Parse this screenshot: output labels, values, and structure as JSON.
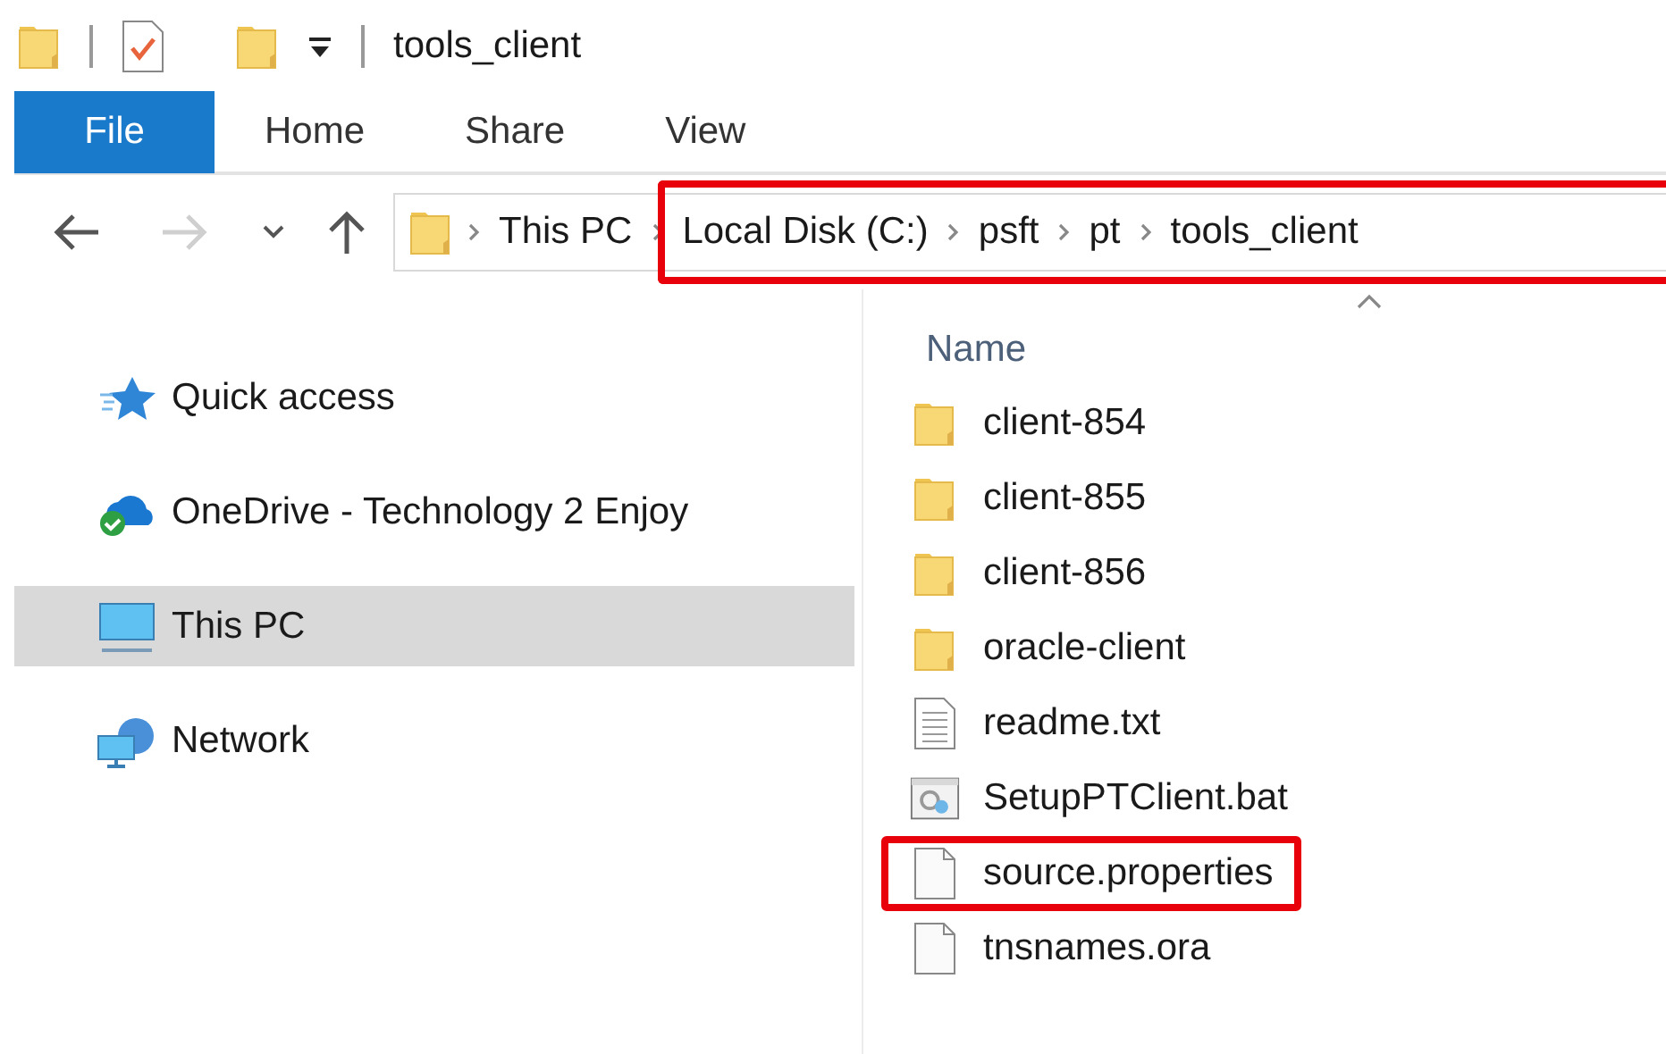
{
  "window": {
    "title": "tools_client"
  },
  "ribbon_tabs": [
    {
      "label": "File",
      "selected": true
    },
    {
      "label": "Home",
      "selected": false
    },
    {
      "label": "Share",
      "selected": false
    },
    {
      "label": "View",
      "selected": false
    }
  ],
  "nav_buttons": [
    {
      "kind": "back",
      "disabled": false
    },
    {
      "kind": "forward",
      "disabled": true
    },
    {
      "kind": "recent",
      "disabled": false
    },
    {
      "kind": "up",
      "disabled": false
    }
  ],
  "address_bar": {
    "segments": [
      {
        "label": "This PC",
        "highlighted": false
      },
      {
        "label": "Local Disk (C:)",
        "highlighted": true
      },
      {
        "label": "psft",
        "highlighted": true
      },
      {
        "label": "pt",
        "highlighted": true
      },
      {
        "label": "tools_client",
        "highlighted": true
      }
    ]
  },
  "sidebar": {
    "items": [
      {
        "label": "Quick access",
        "kind": "quick-access",
        "selected": false
      },
      {
        "label": "OneDrive - Technology 2 Enjoy",
        "kind": "cloud",
        "selected": false
      },
      {
        "label": "This PC",
        "kind": "computer",
        "selected": true
      },
      {
        "label": "Network",
        "kind": "network",
        "selected": false
      }
    ]
  },
  "file_list": {
    "columns": [
      {
        "label": "Name",
        "sorted": true
      }
    ],
    "items": [
      {
        "name": "client-854",
        "kind": "folder",
        "highlighted": false
      },
      {
        "name": "client-855",
        "kind": "folder",
        "highlighted": false
      },
      {
        "name": "client-856",
        "kind": "folder",
        "highlighted": false
      },
      {
        "name": "oracle-client",
        "kind": "folder",
        "highlighted": false
      },
      {
        "name": "readme.txt",
        "kind": "text",
        "highlighted": false
      },
      {
        "name": "SetupPTClient.bat",
        "kind": "batch",
        "highlighted": false
      },
      {
        "name": "source.properties",
        "kind": "file",
        "highlighted": true
      },
      {
        "name": "tnsnames.ora",
        "kind": "file",
        "highlighted": false
      }
    ]
  }
}
